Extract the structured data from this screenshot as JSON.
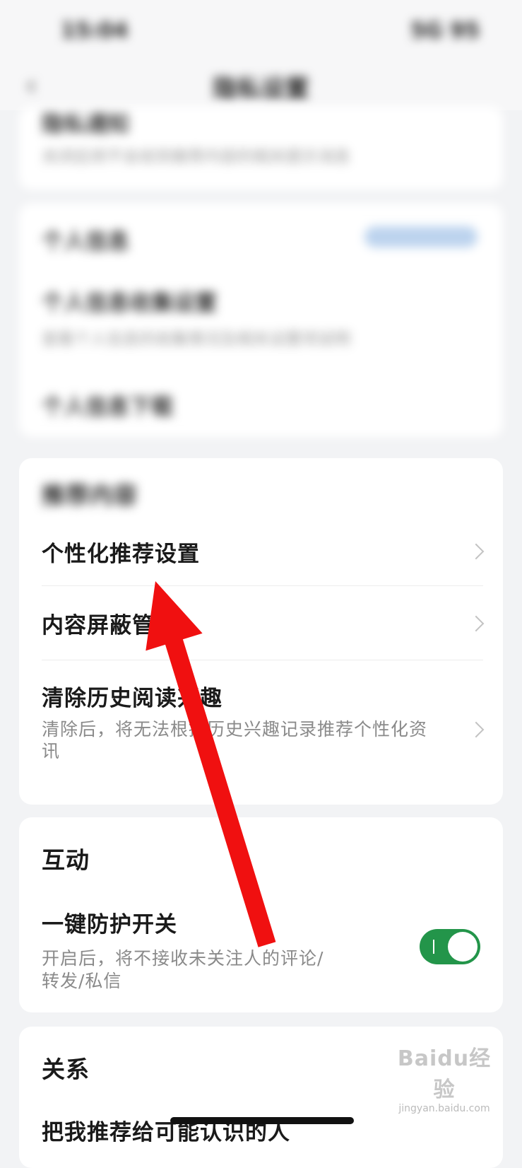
{
  "blurred": {
    "status_time": "15:04",
    "status_right": "5G 95",
    "nav_title": "隐私设置",
    "top_card": {
      "title": "隐私通知",
      "subtitle": "关闭后将不会收到推荐内容的相关提示消息"
    },
    "middle_card": {
      "row1_title": "个人信息",
      "row2_title": "个人信息收集设置",
      "row2_subtitle": "查看个人信息的收集情况及相关设置项说明",
      "row3_title": "个人信息下载"
    },
    "recommend_section_title": "推荐内容"
  },
  "recommend_card": {
    "items": [
      {
        "title": "个性化推荐设置",
        "subtitle": ""
      },
      {
        "title": "内容屏蔽管理",
        "subtitle": ""
      },
      {
        "title": "清除历史阅读兴趣",
        "subtitle": "清除后，将无法根据历史兴趣记录推荐个性化资讯"
      }
    ]
  },
  "interaction_card": {
    "section_title": "互动",
    "toggle_title": "一键防护开关",
    "toggle_subtitle_line1": "开启后，将不接收未关注人的评论/",
    "toggle_subtitle_line2": "转发/私信",
    "toggle_on": true,
    "toggle_color": "#23954a"
  },
  "relation_card": {
    "section_title": "关系",
    "item_title": "把我推荐给可能认识的人"
  },
  "annotation": {
    "arrow_color": "#f01010"
  },
  "watermark": {
    "brand": "Baidu经验",
    "url": "jingyan.baidu.com"
  }
}
